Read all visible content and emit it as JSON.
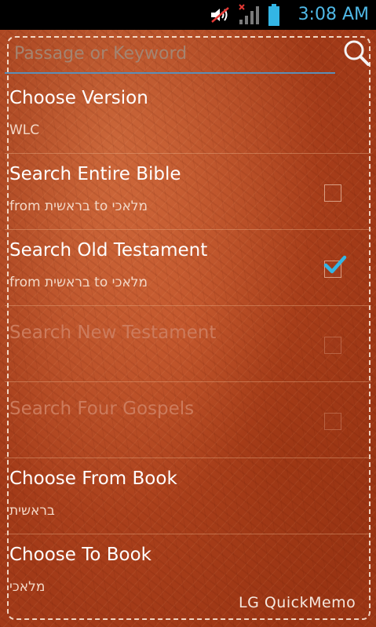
{
  "status_bar": {
    "time": "3:08 AM",
    "icons": [
      "volume-icon",
      "no-signal-icon",
      "battery-icon"
    ]
  },
  "search": {
    "placeholder": "Passage or Keyword",
    "value": ""
  },
  "rows": [
    {
      "title": "Choose Version",
      "subtitle": "WLC",
      "has_checkbox": false,
      "checked": false,
      "enabled": true
    },
    {
      "title": "Search Entire Bible",
      "subtitle": "from בראשית to מלאכי",
      "has_checkbox": true,
      "checked": false,
      "enabled": true
    },
    {
      "title": "Search Old Testament",
      "subtitle": "from בראשית to מלאכי",
      "has_checkbox": true,
      "checked": true,
      "enabled": true
    },
    {
      "title": "Search New Testament",
      "subtitle": "",
      "has_checkbox": true,
      "checked": false,
      "enabled": false
    },
    {
      "title": "Search Four Gospels",
      "subtitle": "",
      "has_checkbox": true,
      "checked": false,
      "enabled": false
    },
    {
      "title": "Choose From Book",
      "subtitle": "בראשית",
      "has_checkbox": false,
      "checked": false,
      "enabled": true
    },
    {
      "title": "Choose To Book",
      "subtitle": "מלאכי",
      "has_checkbox": false,
      "checked": false,
      "enabled": true
    }
  ],
  "watermark": "LG QuickMemo",
  "colors": {
    "accent": "#33b5e5",
    "leather": "#b4451f",
    "check": "#33b5e5"
  }
}
